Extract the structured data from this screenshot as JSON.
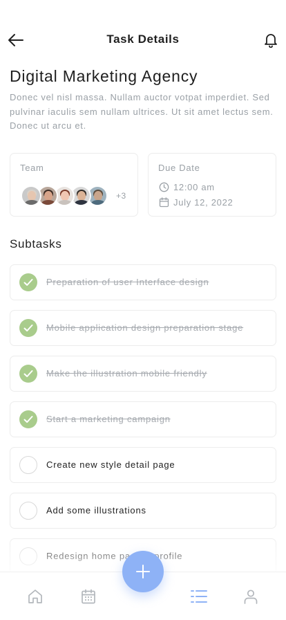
{
  "header": {
    "title": "Task Details",
    "back_icon": "arrow-left-icon",
    "notification_icon": "bell-icon"
  },
  "project": {
    "title": "Digital Marketing Agency",
    "description": "Donec vel nisl massa. Nullam auctor votpat imperdiet. Sed pulvinar iaculis sem nullam ultrices. Ut sit amet lectus sem. Donec ut arcu et."
  },
  "team": {
    "label": "Team",
    "more_count": "+3",
    "avatars": [
      {
        "name": "avatar-1",
        "skin": "#e6c6b0",
        "hair": "#d9d2c9",
        "shirt": "#6b6b6b",
        "bg": "#c9c9c9"
      },
      {
        "name": "avatar-2",
        "skin": "#d7a48a",
        "hair": "#3a2a22",
        "shirt": "#7b4a3a",
        "bg": "#b9a79b"
      },
      {
        "name": "avatar-3",
        "skin": "#f0c7b3",
        "hair": "#7a3a2a",
        "shirt": "#c9c2bd",
        "bg": "#e8e3df"
      },
      {
        "name": "avatar-4",
        "skin": "#dcb497",
        "hair": "#2f2a26",
        "shirt": "#2e3440",
        "bg": "#d8d8d8"
      },
      {
        "name": "avatar-5",
        "skin": "#c9a58c",
        "hair": "#5a4b3d",
        "shirt": "#4e6b7d",
        "bg": "#9fb3bf"
      }
    ]
  },
  "due_date": {
    "label": "Due Date",
    "time": "12:00 am",
    "date": "July 12, 2022",
    "time_icon": "clock-icon",
    "date_icon": "calendar-icon"
  },
  "subtasks_section": {
    "title": "Subtasks",
    "items": [
      {
        "label": "Preparation of user Interface design",
        "done": true
      },
      {
        "label": "Mobile application design preparation stage",
        "done": true
      },
      {
        "label": "Make the illustration mobile friendly",
        "done": true
      },
      {
        "label": "Start a marketing campaign",
        "done": true
      },
      {
        "label": "Create new style detail page",
        "done": false
      },
      {
        "label": "Add some illustrations",
        "done": false
      },
      {
        "label": "Redesign home page & profile",
        "done": false
      }
    ]
  },
  "tabbar": {
    "tabs": [
      {
        "name": "tab-home",
        "icon": "home-icon",
        "active": false
      },
      {
        "name": "tab-calendar",
        "icon": "calendar-icon",
        "active": false
      },
      {
        "name": "tab-tasks",
        "icon": "list-icon",
        "active": true
      },
      {
        "name": "tab-profile",
        "icon": "user-icon",
        "active": false
      }
    ],
    "add_icon": "plus-icon"
  },
  "colors": {
    "accent": "#8eb2f6",
    "done": "#a9cc8c",
    "muted_text": "#9aa0a6",
    "inactive_icon": "#b3b7bc"
  }
}
